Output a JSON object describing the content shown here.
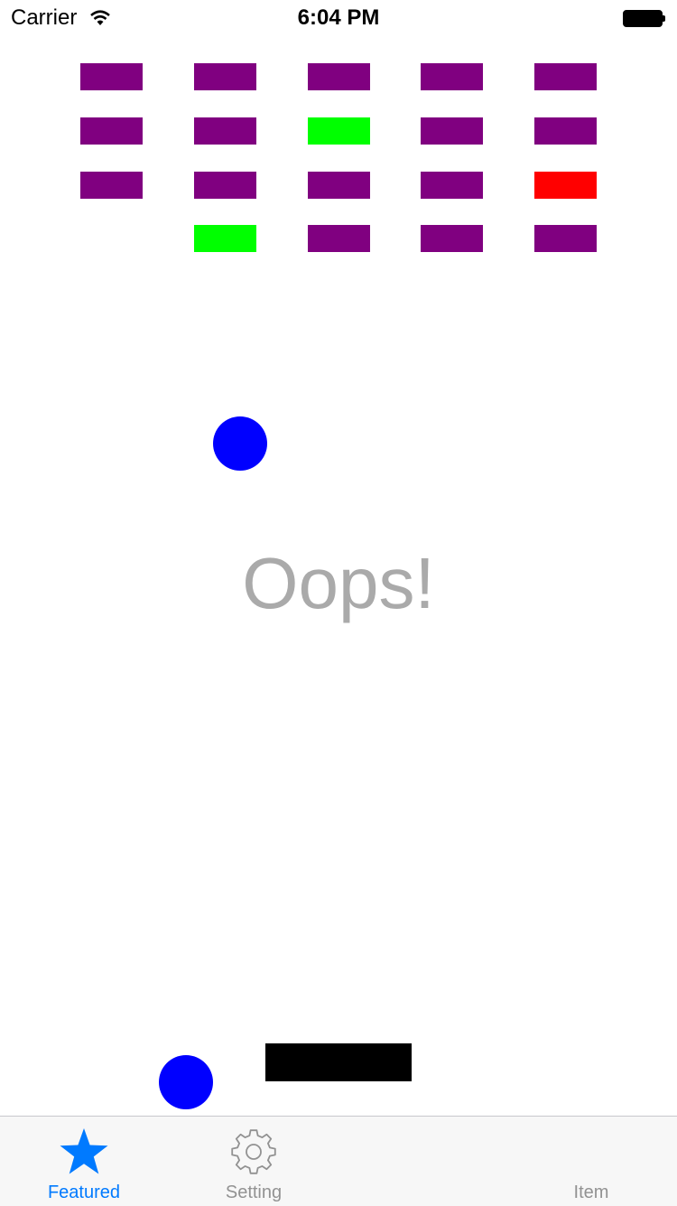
{
  "status_bar": {
    "carrier": "Carrier",
    "time": "6:04 PM"
  },
  "game": {
    "message": "Oops!",
    "colors": {
      "purple": "#800080",
      "green": "#00ff00",
      "red": "#ff0000",
      "ball": "#0000ff",
      "paddle": "#000000"
    },
    "bricks": [
      [
        "purple",
        "purple",
        "purple",
        "purple",
        "purple"
      ],
      [
        "purple",
        "purple",
        "green",
        "purple",
        "purple"
      ],
      [
        "purple",
        "purple",
        "purple",
        "purple",
        "red"
      ],
      [
        null,
        "green",
        "purple",
        "purple",
        "purple"
      ]
    ]
  },
  "tab_bar": {
    "active_color": "#007aff",
    "inactive_color": "#929292",
    "tabs": [
      {
        "label": "Featured",
        "icon": "star-icon",
        "active": true
      },
      {
        "label": "Setting",
        "icon": "gear-icon",
        "active": false
      },
      {
        "label": "Item",
        "icon": "",
        "active": false
      }
    ]
  }
}
